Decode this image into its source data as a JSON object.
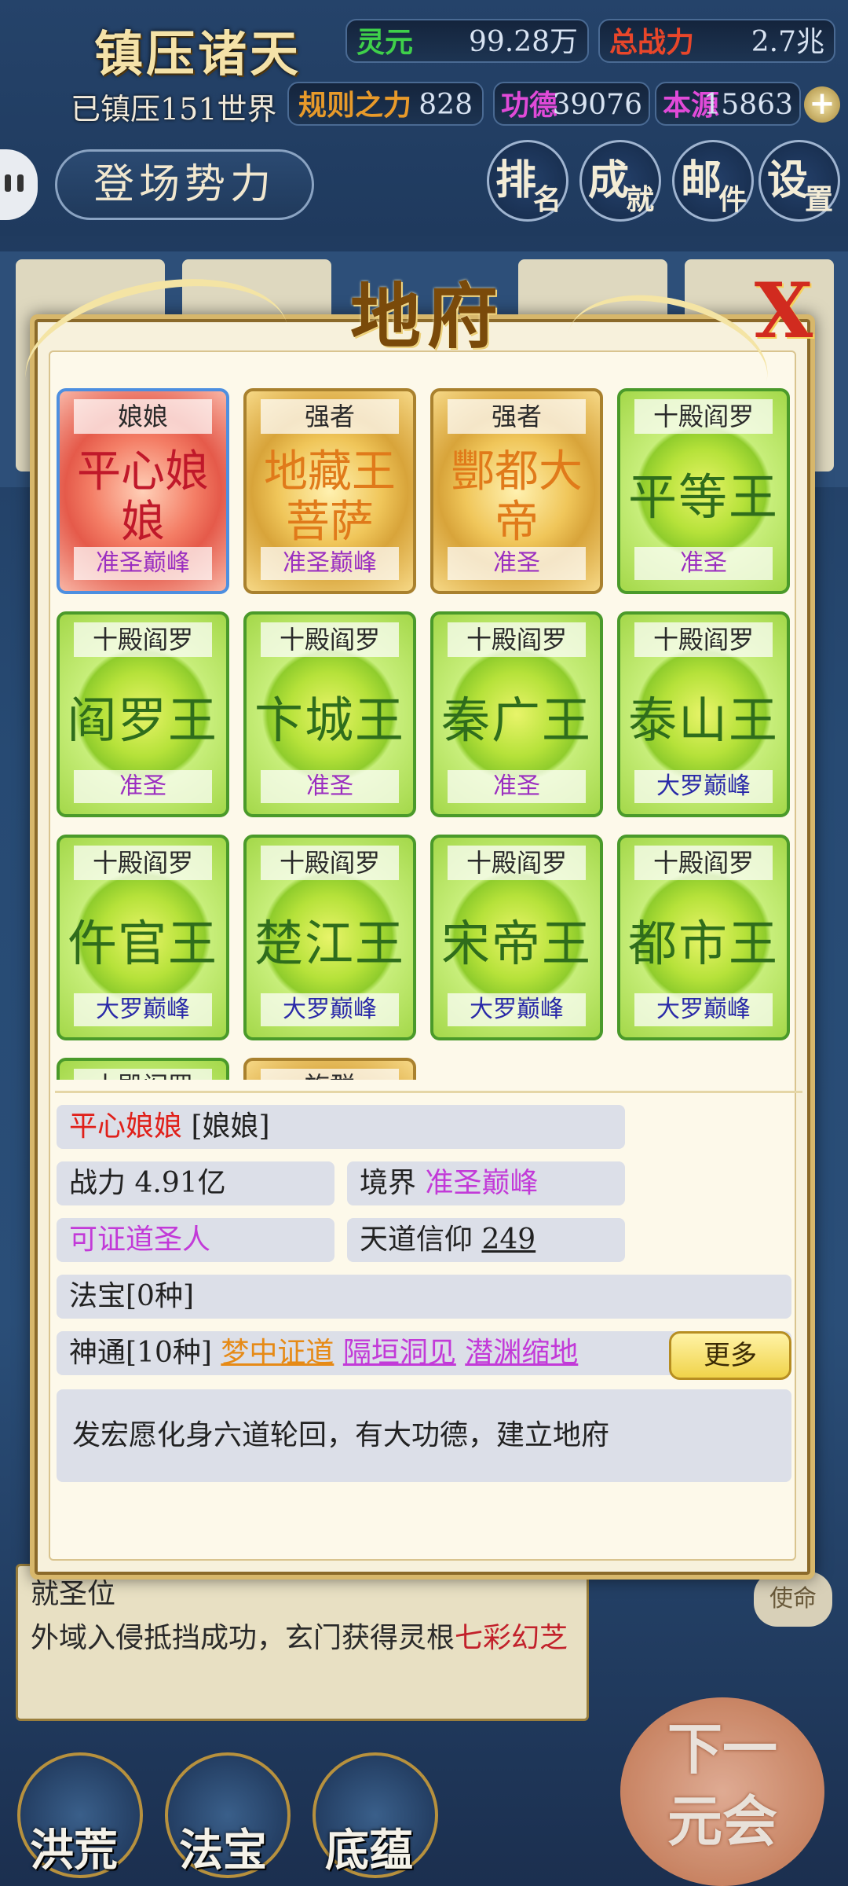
{
  "header": {
    "game_title": "镇压诸天",
    "suppressed": "已镇压151世界",
    "stats": {
      "lingyuan": {
        "label": "灵元",
        "value": "99.28万"
      },
      "power": {
        "label": "总战力",
        "value": "2.7兆"
      },
      "rules": {
        "label": "规则之力",
        "value": "828"
      },
      "merit": {
        "label": "功德",
        "value": "39076"
      },
      "origin": {
        "label": "本源",
        "value": "15863"
      }
    },
    "plus": "+",
    "faction_button": "登场势力",
    "menu": [
      {
        "a": "排",
        "b": "名"
      },
      {
        "a": "成",
        "b": "就"
      },
      {
        "a": "邮",
        "b": "件"
      },
      {
        "a": "设",
        "b": "置"
      }
    ]
  },
  "modal": {
    "title": "地府",
    "close": "X",
    "cards": [
      {
        "top": "娘娘",
        "name": "平心娘娘",
        "rank": "准圣巅峰",
        "style": "red",
        "rank_color": "purple"
      },
      {
        "top": "强者",
        "name": "地藏王菩萨",
        "rank": "准圣巅峰",
        "style": "gold",
        "rank_color": "purple"
      },
      {
        "top": "强者",
        "name": "酆都大帝",
        "rank": "准圣",
        "style": "gold",
        "rank_color": "purple"
      },
      {
        "top": "十殿阎罗",
        "name": "平等王",
        "rank": "准圣",
        "style": "green",
        "rank_color": "purple"
      },
      {
        "top": "十殿阎罗",
        "name": "阎罗王",
        "rank": "准圣",
        "style": "green",
        "rank_color": "purple"
      },
      {
        "top": "十殿阎罗",
        "name": "卞城王",
        "rank": "准圣",
        "style": "green",
        "rank_color": "purple"
      },
      {
        "top": "十殿阎罗",
        "name": "秦广王",
        "rank": "准圣",
        "style": "green",
        "rank_color": "purple"
      },
      {
        "top": "十殿阎罗",
        "name": "泰山王",
        "rank": "大罗巅峰",
        "style": "green",
        "rank_color": "blue"
      },
      {
        "top": "十殿阎罗",
        "name": "仵官王",
        "rank": "大罗巅峰",
        "style": "green",
        "rank_color": "blue"
      },
      {
        "top": "十殿阎罗",
        "name": "楚江王",
        "rank": "大罗巅峰",
        "style": "green",
        "rank_color": "blue"
      },
      {
        "top": "十殿阎罗",
        "name": "宋帝王",
        "rank": "大罗巅峰",
        "style": "green",
        "rank_color": "blue"
      },
      {
        "top": "十殿阎罗",
        "name": "都市王",
        "rank": "大罗巅峰",
        "style": "green",
        "rank_color": "blue"
      },
      {
        "top": "十殿阎罗",
        "name": "",
        "rank": "",
        "style": "green",
        "rank_color": "blue"
      },
      {
        "top": "族群",
        "name": "",
        "rank": "",
        "style": "gold",
        "rank_color": "blue"
      }
    ],
    "info": {
      "name": "平心娘娘",
      "title": "[娘娘]",
      "power_label": "战力",
      "power_value": "4.91亿",
      "realm_label": "境界",
      "realm_value": "准圣巅峰",
      "status": "可证道圣人",
      "faith_label": "天道信仰",
      "faith_value": "249",
      "treasure": "法宝[0种]",
      "skills_label": "神通[10种]",
      "skills": [
        "梦中证道",
        "隔垣洞见",
        "潜渊缩地"
      ],
      "more": "更多",
      "description": "发宏愿化身六道轮回，有大功德，建立地府"
    }
  },
  "background": {
    "log_line1": "就圣位",
    "log_line2": "外域入侵抵挡成功，玄门获得灵根",
    "log_highlight": "七彩幻芝",
    "mission": "使命",
    "bottom": [
      "洪荒",
      "法宝",
      "底蕴"
    ],
    "next_era": "下一元会"
  },
  "colors": {
    "card_green_border": "#4a9a2a",
    "card_gold_border": "#a9812e",
    "card_selected_border": "#4d8fe0",
    "rank_purple": "#9b2fc0",
    "rank_blue": "#2a2aa8",
    "modal_bg": "#fdf9ea"
  }
}
